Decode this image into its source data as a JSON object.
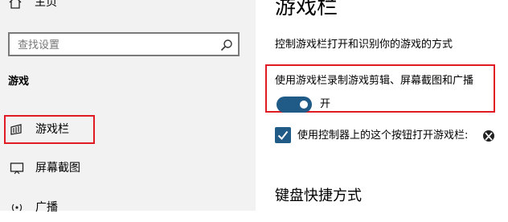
{
  "sidebar": {
    "home_label": "主页",
    "search_placeholder": "查找设置",
    "group_label": "游戏",
    "items": [
      {
        "label": "游戏栏",
        "icon": "game-bar-icon",
        "selected": true
      },
      {
        "label": "屏幕截图",
        "icon": "screen-capture-icon"
      },
      {
        "label": "广播",
        "icon": "broadcast-icon"
      }
    ]
  },
  "main": {
    "title": "游戏栏",
    "description": "控制游戏栏打开和识别你的游戏的方式",
    "toggle": {
      "label": "使用游戏栏录制游戏剪辑、屏幕截图和广播",
      "state": "开",
      "on": true
    },
    "checkbox": {
      "label": "使用控制器上的这个按钮打开游戏栏:",
      "checked": true,
      "icon": "xbox-icon"
    },
    "section_title": "键盘快捷方式"
  },
  "colors": {
    "accent": "#1f5b86",
    "highlight_border": "#e01b24",
    "sidebar_bg": "#f2f2f2"
  }
}
